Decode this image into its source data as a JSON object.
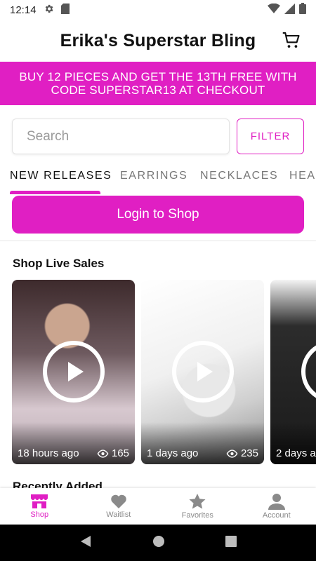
{
  "status_bar": {
    "time": "12:14"
  },
  "header": {
    "title": "Erika's Superstar Bling"
  },
  "promo": {
    "text": "BUY 12 PIECES AND GET THE 13TH FREE WITH CODE SUPERSTAR13 AT CHECKOUT"
  },
  "search": {
    "placeholder": "Search",
    "value": "",
    "filter_label": "FILTER"
  },
  "tabs": [
    "NEW RELEASES",
    "EARRINGS",
    "NECKLACES",
    "HEA"
  ],
  "login": {
    "label": "Login to Shop"
  },
  "live_sales": {
    "title": "Shop Live Sales",
    "items": [
      {
        "time": "18 hours ago",
        "views": "165"
      },
      {
        "time": "1 days ago",
        "views": "235"
      },
      {
        "time": "2 days a",
        "views": ""
      }
    ]
  },
  "recent": {
    "title": "Recently Added"
  },
  "bottom_nav": [
    {
      "label": "Shop",
      "icon": "store-icon",
      "active": true
    },
    {
      "label": "Waitlist",
      "icon": "heart-icon",
      "active": false
    },
    {
      "label": "Favorites",
      "icon": "star-icon",
      "active": false
    },
    {
      "label": "Account",
      "icon": "person-icon",
      "active": false
    }
  ],
  "colors": {
    "accent": "#e01fc3"
  }
}
